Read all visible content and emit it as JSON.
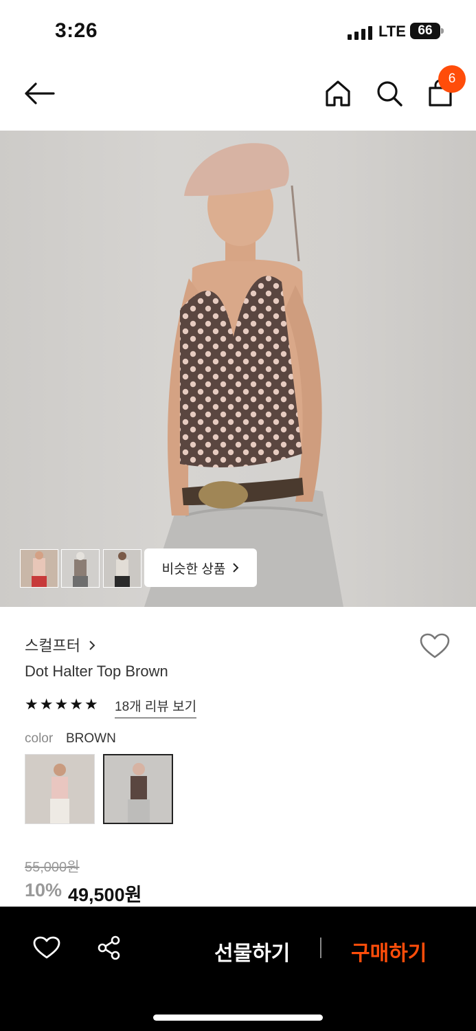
{
  "status_bar": {
    "time": "3:26",
    "network": "LTE",
    "battery": "66"
  },
  "header": {
    "cart_count": "6"
  },
  "gallery": {
    "similar_button": "비슷한 상품",
    "thumbnail_count": 3
  },
  "product": {
    "brand": "스컬프터",
    "title": "Dot Halter Top Brown",
    "rating_stars": 5,
    "review_link": "18개 리뷰 보기",
    "color_label": "color",
    "color_value": "BROWN",
    "original_price": "55,000원",
    "discount": "10%",
    "sale_price": "49,500원"
  },
  "bottom_bar": {
    "gift_label": "선물하기",
    "buy_label": "구매하기"
  },
  "colors": {
    "accent": "#ff4d0a",
    "bar": "#000000"
  }
}
